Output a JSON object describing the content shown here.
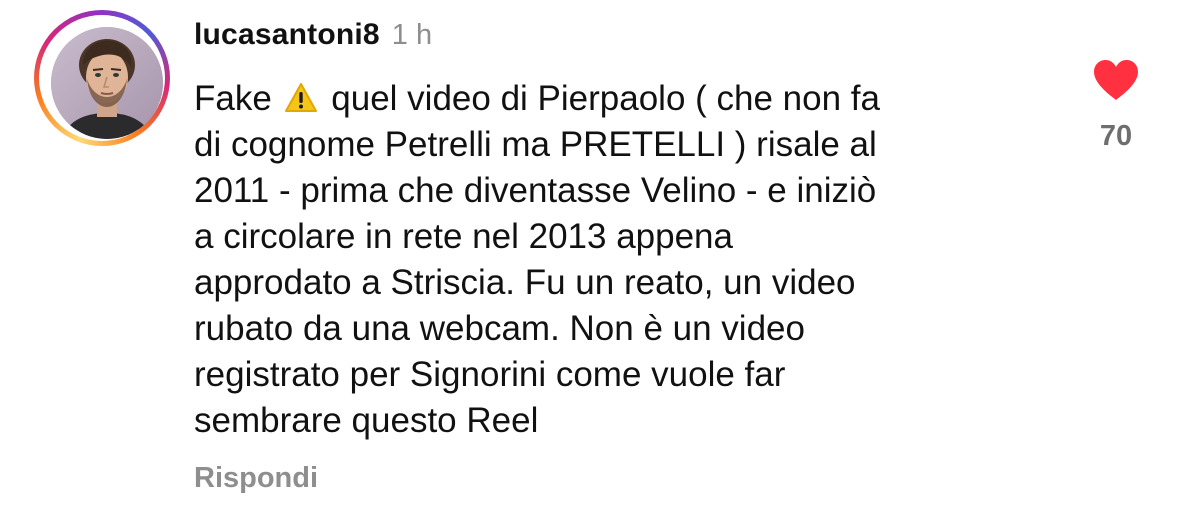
{
  "comment": {
    "username": "lucasantoni8",
    "timestamp": "1 h",
    "text_lines": [
      {
        "before_icon": "Fake",
        "icon": "warning-icon",
        "after_icon": "quel video di Pierpaolo ( che non fa"
      },
      "di cognome Petrelli ma PRETELLI ) risale al",
      "2011 - prima che diventasse Velino - e iniziò",
      "a circolare in rete nel 2013 appena",
      "approdato a Striscia. Fu un reato, un video",
      "rubato da una webcam. Non è un video",
      "registrato per Signorini come vuole far",
      "sembrare questo Reel"
    ],
    "reply_label": "Rispondi",
    "like_count": "70",
    "liked": true
  },
  "colors": {
    "heart": "#ff3040",
    "secondary_text": "#8e8e8e",
    "warning": "#f5c518"
  }
}
